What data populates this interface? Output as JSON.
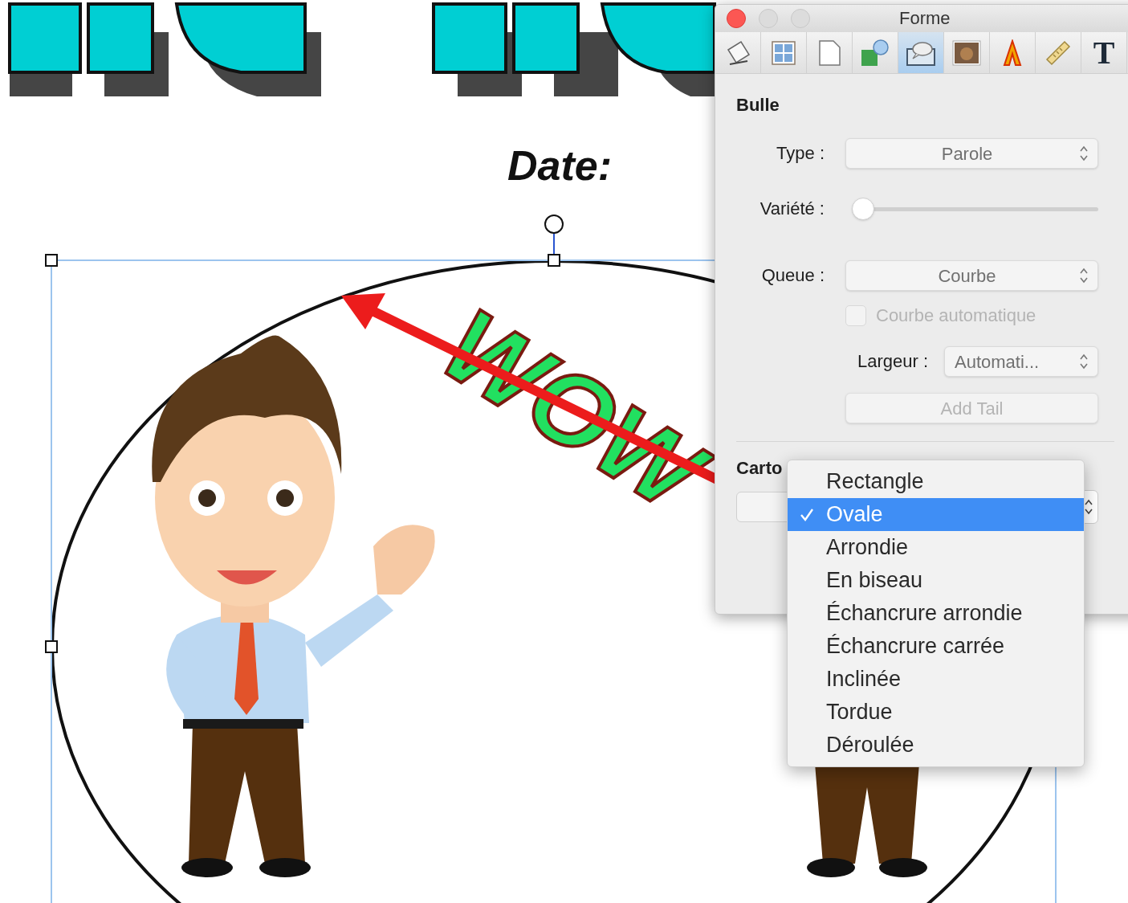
{
  "canvas": {
    "date_label": "Date:",
    "wow_art": "WOW"
  },
  "panel": {
    "title": "Forme",
    "window_buttons": [
      {
        "kind": "close"
      },
      {
        "kind": "minimize"
      },
      {
        "kind": "zoom"
      }
    ],
    "toolbar": [
      {
        "kind": "note",
        "selected": false
      },
      {
        "kind": "grid",
        "selected": false
      },
      {
        "kind": "page",
        "selected": false
      },
      {
        "kind": "shapes",
        "selected": false
      },
      {
        "kind": "bubble",
        "selected": true
      },
      {
        "kind": "photo",
        "selected": false
      },
      {
        "kind": "letter-art",
        "selected": false
      },
      {
        "kind": "ruler",
        "selected": false
      },
      {
        "kind": "text",
        "glyph": "T",
        "selected": false
      }
    ],
    "section": "Bulle",
    "type": {
      "label": "Type :",
      "value": "Parole"
    },
    "variety": {
      "label": "Variété :",
      "level": 0
    },
    "tail": {
      "label": "Queue :",
      "value": "Courbe"
    },
    "auto_curve": {
      "label": "Courbe automatique",
      "checked": false,
      "disabled": true
    },
    "width": {
      "label": "Largeur :",
      "value": "Automati..."
    },
    "add_tail": {
      "label": "Add Tail",
      "disabled": true
    },
    "section2": "Carto"
  },
  "menu": {
    "items": [
      {
        "label": "Rectangle",
        "selected": false
      },
      {
        "label": "Ovale",
        "selected": true
      },
      {
        "label": "Arrondie",
        "selected": false
      },
      {
        "label": "En biseau",
        "selected": false
      },
      {
        "label": "Échancrure arrondie",
        "selected": false
      },
      {
        "label": "Échancrure carrée",
        "selected": false
      },
      {
        "label": "Inclinée",
        "selected": false
      },
      {
        "label": "Tordue",
        "selected": false
      },
      {
        "label": "Déroulée",
        "selected": false
      }
    ]
  }
}
